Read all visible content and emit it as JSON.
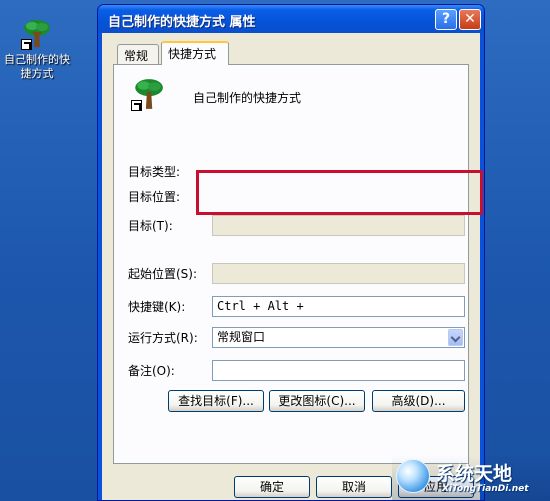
{
  "desktop": {
    "icon_label": "自己制作的快捷方式"
  },
  "window": {
    "title": "自己制作的快捷方式 属性",
    "help_glyph": "?",
    "close_glyph": "✕"
  },
  "tabs": [
    {
      "label": "常规"
    },
    {
      "label": "快捷方式"
    }
  ],
  "panel": {
    "name": "自己制作的快捷方式",
    "target_type_label": "目标类型:",
    "target_location_label": "目标位置:",
    "target_label": "目标(T):",
    "target_value": "",
    "start_in_label": "起始位置(S):",
    "start_in_value": "",
    "hotkey_label": "快捷键(K):",
    "hotkey_value": "Ctrl + Alt +",
    "run_label": "运行方式(R):",
    "run_value": "常规窗口",
    "comment_label": "备注(O):",
    "comment_value": "",
    "find_target": "查找目标(F)...",
    "change_icon": "更改图标(C)...",
    "advanced": "高级(D)..."
  },
  "footer": {
    "ok": "确定",
    "cancel": "取消",
    "apply": "应用"
  },
  "watermark": {
    "title": "系统天地",
    "url": "XiTongTianDi.net"
  },
  "colors": {
    "highlight_box": "#c8102e",
    "xp_blue": "#0553d9",
    "dialog_face": "#ece9d8"
  },
  "icons": {
    "shortcut": "tree-shortcut-icon",
    "help": "help-icon",
    "close": "close-icon"
  }
}
